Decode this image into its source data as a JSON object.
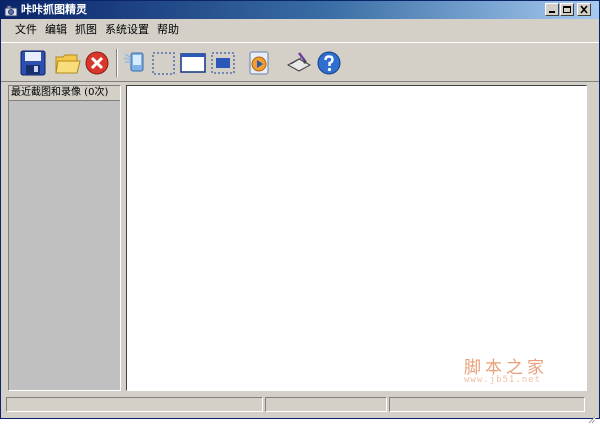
{
  "window": {
    "title": "咔咔抓图精灵",
    "icons": {
      "app": "camera-icon",
      "minimize": "minimize-icon",
      "maximize": "maximize-icon",
      "close": "close-icon"
    }
  },
  "menu": [
    {
      "label": "文件"
    },
    {
      "label": "编辑"
    },
    {
      "label": "抓图"
    },
    {
      "label": "系统设置"
    },
    {
      "label": "帮助"
    }
  ],
  "toolbar": {
    "items": [
      {
        "icon": "save-icon"
      },
      {
        "icon": "open-folder-icon"
      },
      {
        "icon": "delete-icon"
      },
      {
        "icon": "capture-screen-icon"
      },
      {
        "icon": "capture-region-icon"
      },
      {
        "icon": "capture-window-icon"
      },
      {
        "icon": "capture-object-icon"
      },
      {
        "icon": "record-icon"
      },
      {
        "icon": "settings-icon"
      },
      {
        "icon": "help-icon"
      }
    ]
  },
  "left_panel": {
    "title": "最近截图和录像 (0次)"
  },
  "watermark": {
    "text": "脚本之家",
    "url": "www.jb51.net"
  },
  "status": {
    "cells": [
      "",
      "",
      ""
    ]
  }
}
